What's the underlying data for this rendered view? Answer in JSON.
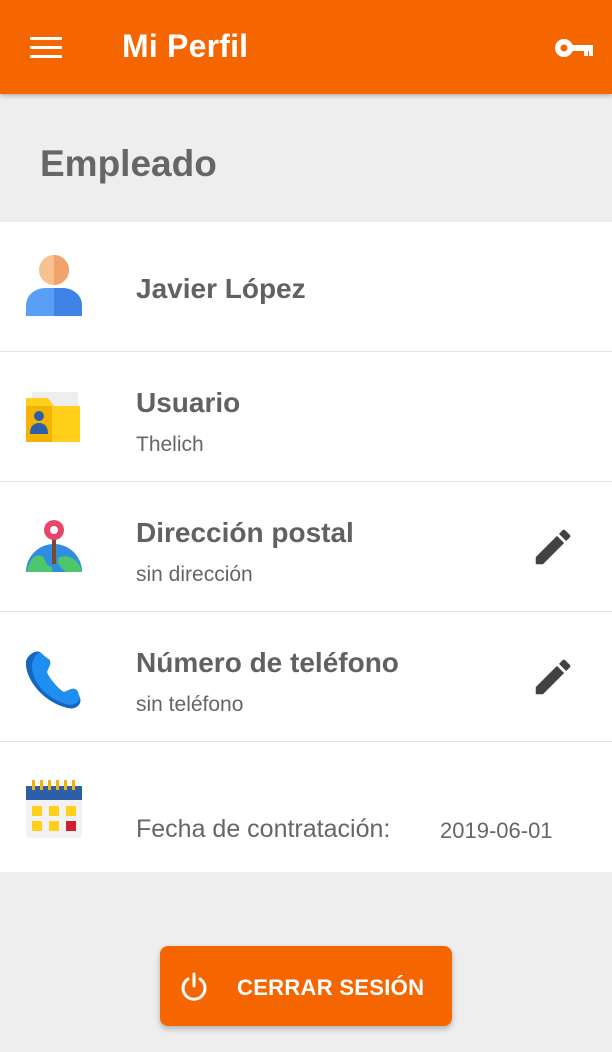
{
  "app_bar": {
    "title": "Mi Perfil",
    "menu_icon": "hamburger-menu-icon",
    "key_icon": "key-icon",
    "color": "#f56600"
  },
  "section": {
    "title": "Empleado"
  },
  "profile": {
    "name": "Javier López",
    "user_label": "Usuario",
    "user_value": "Thelich",
    "address_label": "Dirección postal",
    "address_value": "sin dirección",
    "phone_label": "Número de teléfono",
    "phone_value": "sin teléfono",
    "hire_label": "Fecha de contratación:",
    "hire_value": "2019-06-01"
  },
  "logout": {
    "label": "CERRAR SESIÓN",
    "icon": "power-icon"
  }
}
